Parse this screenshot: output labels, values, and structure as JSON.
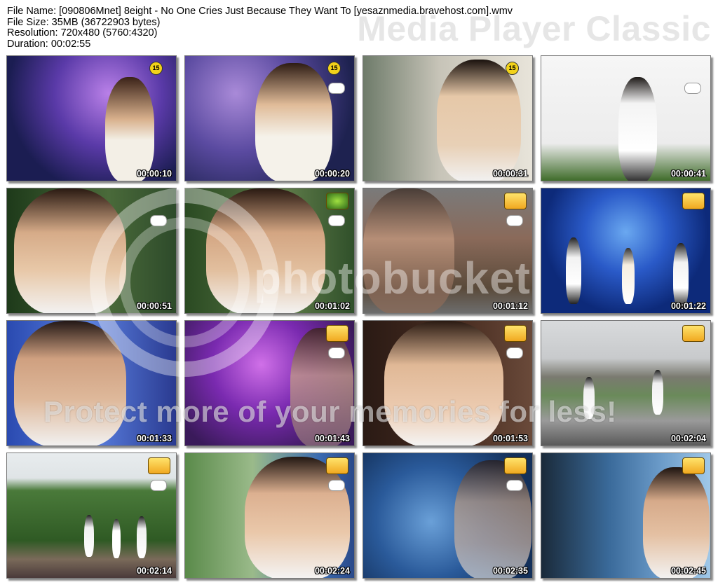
{
  "header": {
    "file_name": "File Name: [090806Mnet] 8eight - No One Cries Just Because They Want To [yesaznmedia.bravehost.com].wmv",
    "file_size": "File Size: 35MB (36722903 bytes)",
    "resolution": "Resolution: 720x480 (5760:4320)",
    "duration": "Duration: 00:02:55"
  },
  "app_title": "Media Player Classic",
  "watermark": {
    "brand": "photobucket",
    "slogan": "Protect more of your memories for less!"
  },
  "thumbnails": [
    {
      "time": "00:00:10"
    },
    {
      "time": "00:00:20"
    },
    {
      "time": "00:00:31"
    },
    {
      "time": "00:00:41"
    },
    {
      "time": "00:00:51"
    },
    {
      "time": "00:01:02"
    },
    {
      "time": "00:01:12"
    },
    {
      "time": "00:01:22"
    },
    {
      "time": "00:01:33"
    },
    {
      "time": "00:01:43"
    },
    {
      "time": "00:01:53"
    },
    {
      "time": "00:02:04"
    },
    {
      "time": "00:02:14"
    },
    {
      "time": "00:02:24"
    },
    {
      "time": "00:02:35"
    },
    {
      "time": "00:02:45"
    }
  ],
  "rating_badge": "15"
}
